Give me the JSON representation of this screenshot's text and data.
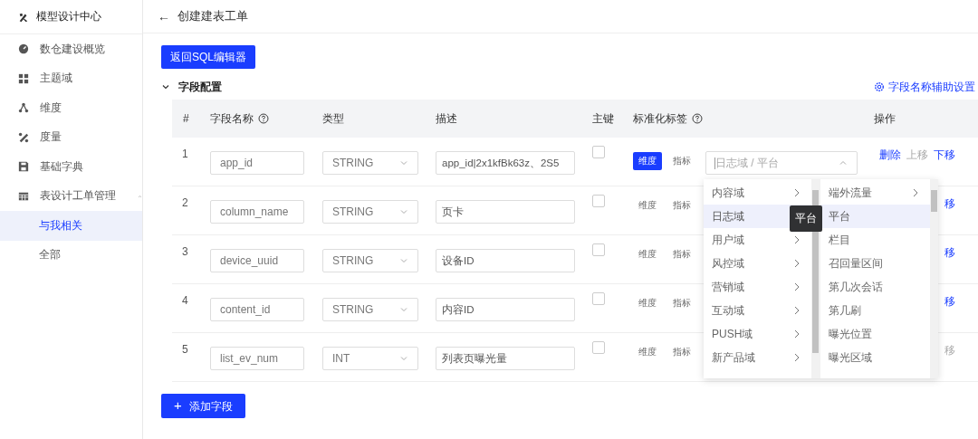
{
  "sidebar": {
    "title": "模型设计中心",
    "items": [
      {
        "label": "数仓建设概览",
        "selected": false
      },
      {
        "label": "主题域",
        "selected": false
      },
      {
        "label": "维度",
        "selected": false
      },
      {
        "label": "度量",
        "selected": false
      },
      {
        "label": "基础字典",
        "selected": false
      },
      {
        "label": "表设计工单管理",
        "selected": false,
        "expanded": true,
        "children": [
          {
            "label": "与我相关",
            "selected": true
          },
          {
            "label": "全部",
            "selected": false
          }
        ]
      }
    ]
  },
  "header": {
    "back": "←",
    "title": "创建建表工单"
  },
  "back_button": "返回SQL编辑器",
  "section": {
    "title": "字段配置",
    "expanded": true,
    "assist_link": "字段名称辅助设置"
  },
  "table": {
    "columns": [
      {
        "label": "#"
      },
      {
        "label": "字段名称",
        "help": true
      },
      {
        "label": "类型"
      },
      {
        "label": "描述"
      },
      {
        "label": "主键"
      },
      {
        "label": "标准化标签",
        "help": true
      },
      {
        "label": "操作"
      }
    ],
    "rows": [
      {
        "index": "1",
        "name": "app_id",
        "type": "STRING",
        "description": "app_id|2x1kfBk63z、2S5",
        "primary_key": false,
        "tags": [
          {
            "label": "维度",
            "selected": true
          },
          {
            "label": "指标",
            "selected": false
          }
        ],
        "cascader": {
          "placeholder": "日志域 / 平台",
          "open": true
        },
        "actions": [
          {
            "label": "删除",
            "disabled": false
          },
          {
            "label": "上移",
            "disabled": true
          },
          {
            "label": "下移",
            "disabled": false
          }
        ]
      },
      {
        "index": "2",
        "name": "column_name",
        "type": "STRING",
        "description": "页卡",
        "primary_key": false,
        "tags": [
          {
            "label": "维度",
            "selected": false
          },
          {
            "label": "指标",
            "selected": false
          }
        ],
        "actions": [
          {
            "label": "移",
            "disabled": false
          }
        ]
      },
      {
        "index": "3",
        "name": "device_uuid",
        "type": "STRING",
        "description": "设备ID",
        "primary_key": false,
        "tags": [
          {
            "label": "维度",
            "selected": false
          },
          {
            "label": "指标",
            "selected": false
          }
        ],
        "actions": [
          {
            "label": "移",
            "disabled": false
          }
        ]
      },
      {
        "index": "4",
        "name": "content_id",
        "type": "STRING",
        "description": "内容ID",
        "primary_key": false,
        "tags": [
          {
            "label": "维度",
            "selected": false
          },
          {
            "label": "指标",
            "selected": false
          }
        ],
        "actions": [
          {
            "label": "移",
            "disabled": false
          }
        ]
      },
      {
        "index": "5",
        "name": "list_ev_num",
        "type": "INT",
        "description": "列表页曝光量",
        "primary_key": false,
        "tags": [
          {
            "label": "维度",
            "selected": false
          },
          {
            "label": "指标",
            "selected": false
          }
        ],
        "actions": [
          {
            "label": "移",
            "disabled": true
          }
        ]
      }
    ]
  },
  "dropdown": {
    "level_1": [
      {
        "label": "内容域",
        "selected": false
      },
      {
        "label": "日志域",
        "selected": true
      },
      {
        "label": "用户域",
        "selected": false
      },
      {
        "label": "风控域",
        "selected": false
      },
      {
        "label": "营销域",
        "selected": false
      },
      {
        "label": "互动域",
        "selected": false
      },
      {
        "label": "PUSH域",
        "selected": false
      },
      {
        "label": "新产品域",
        "selected": false
      }
    ],
    "level_2": [
      {
        "label": "端外流量",
        "selected": false,
        "has_children": true
      },
      {
        "label": "平台",
        "selected": true,
        "has_children": false
      },
      {
        "label": "栏目",
        "selected": false,
        "has_children": false
      },
      {
        "label": "召回量区间",
        "selected": false,
        "has_children": false
      },
      {
        "label": "第几次会话",
        "selected": false,
        "has_children": false
      },
      {
        "label": "第几刷",
        "selected": false,
        "has_children": false
      },
      {
        "label": "曝光位置",
        "selected": false,
        "has_children": false
      },
      {
        "label": "曝光区域",
        "selected": false,
        "has_children": false
      }
    ],
    "tooltip": "平台"
  },
  "add_button": {
    "icon": "+",
    "label": "添加字段"
  }
}
